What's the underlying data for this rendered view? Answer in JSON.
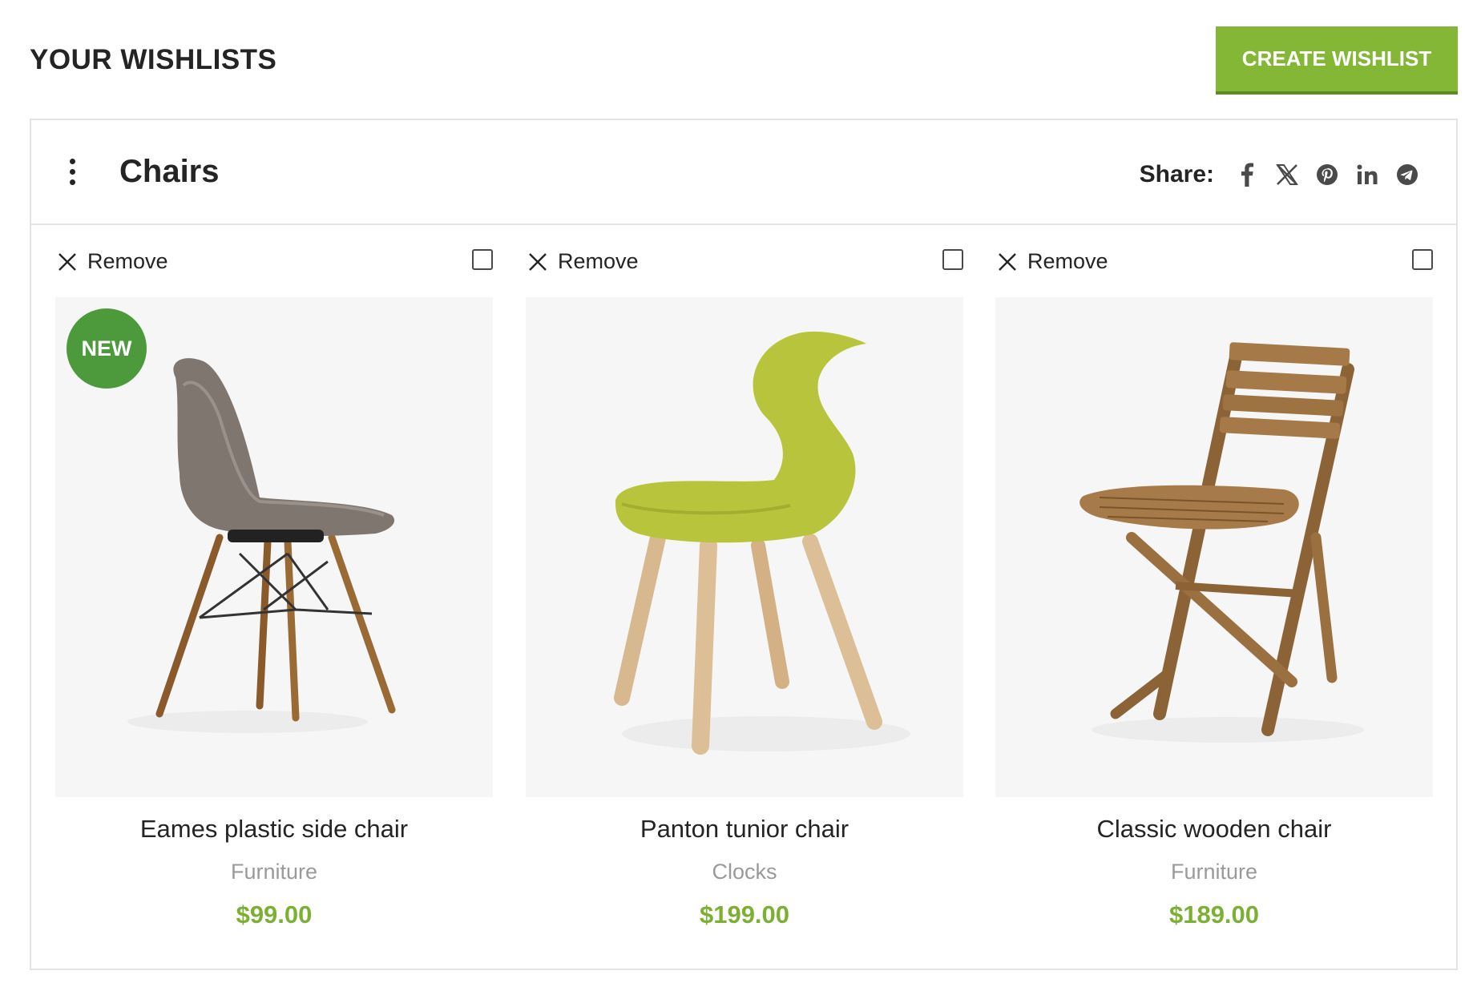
{
  "page": {
    "title": "YOUR WISHLISTS",
    "create_button": "CREATE WISHLIST"
  },
  "wishlist": {
    "name": "Chairs",
    "share_label": "Share:",
    "share_icons": [
      "facebook-icon",
      "x-icon",
      "pinterest-icon",
      "linkedin-icon",
      "telegram-icon"
    ]
  },
  "products": [
    {
      "remove_label": "Remove",
      "badge": "NEW",
      "name": "Eames plastic side chair",
      "category": "Furniture",
      "price": "$99.00",
      "checked": false
    },
    {
      "remove_label": "Remove",
      "badge": "",
      "name": "Panton tunior chair",
      "category": "Clocks",
      "price": "$199.00",
      "checked": false
    },
    {
      "remove_label": "Remove",
      "badge": "",
      "name": "Classic wooden chair",
      "category": "Furniture",
      "price": "$189.00",
      "checked": false
    }
  ],
  "colors": {
    "accent": "#83b735",
    "price": "#7cb033",
    "badge": "#4c9a3b",
    "text": "#242424",
    "muted": "#9a9a9a",
    "border": "#e4e4e4"
  }
}
